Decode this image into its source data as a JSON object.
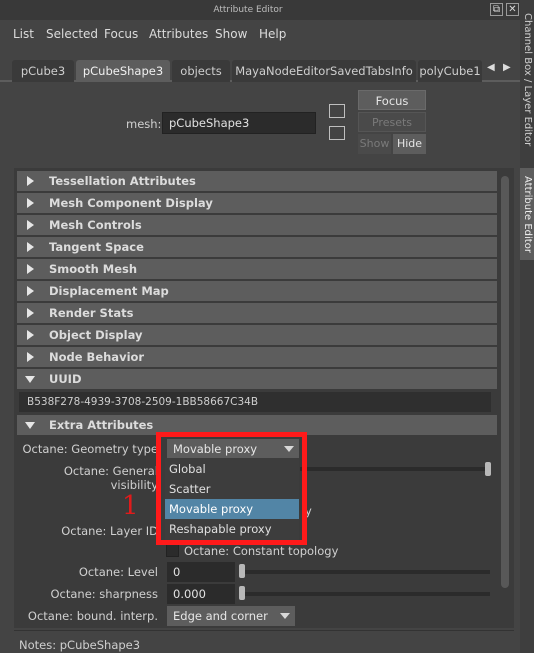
{
  "window": {
    "title": "Attribute Editor",
    "float_icon": "⧉",
    "close_icon": "✕"
  },
  "menu": [
    "List",
    "Selected",
    "Focus",
    "Attributes",
    "Show",
    "Help"
  ],
  "tabs": [
    {
      "label": "pCube3",
      "active": false
    },
    {
      "label": "pCubeShape3",
      "active": true
    },
    {
      "label": "objects",
      "active": false
    },
    {
      "label": "MayaNodeEditorSavedTabsInfo",
      "active": false
    },
    {
      "label": "polyCube1",
      "active": false
    }
  ],
  "tab_scroll": {
    "left": "◀",
    "right": "▶"
  },
  "mesh": {
    "label": "mesh:",
    "value": "pCubeShape3"
  },
  "buttons": {
    "focus": "Focus",
    "presets": "Presets",
    "show": "Show",
    "hide": "Hide"
  },
  "sections": [
    "Tessellation Attributes",
    "Mesh Component Display",
    "Mesh Controls",
    "Tangent Space",
    "Smooth Mesh",
    "Displacement Map",
    "Render Stats",
    "Object Display",
    "Node Behavior",
    "UUID",
    "Extra Attributes"
  ],
  "uuid_value": "B538F278-4939-3708-2509-1BB58667C34B",
  "extra": {
    "geometry_type_label": "Octane: Geometry type",
    "geometry_type_value": "Movable proxy",
    "general_visibility_label": "Octane: General visibility",
    "partial_hidden_text": "y",
    "layer_id_label": "Octane: Layer ID",
    "constant_topology_label": "Octane: Constant topology",
    "level_label": "Octane: Level",
    "level_value": "0",
    "sharpness_label": "Octane: sharpness",
    "sharpness_value": "0.000",
    "bound_interp_label": "Octane: bound. interp.",
    "bound_interp_value": "Edge and corner"
  },
  "dropdown": {
    "options": [
      "Global",
      "Scatter",
      "Movable proxy",
      "Reshapable proxy"
    ],
    "selected_index": 2,
    "highlight_color": "#ff1a1a",
    "selection_color": "#5285a6"
  },
  "annotation": "1",
  "notes": "Notes:  pCubeShape3",
  "right_tabs": {
    "channel": "Channel Box / Layer Editor",
    "attribute": "Attribute Editor"
  }
}
